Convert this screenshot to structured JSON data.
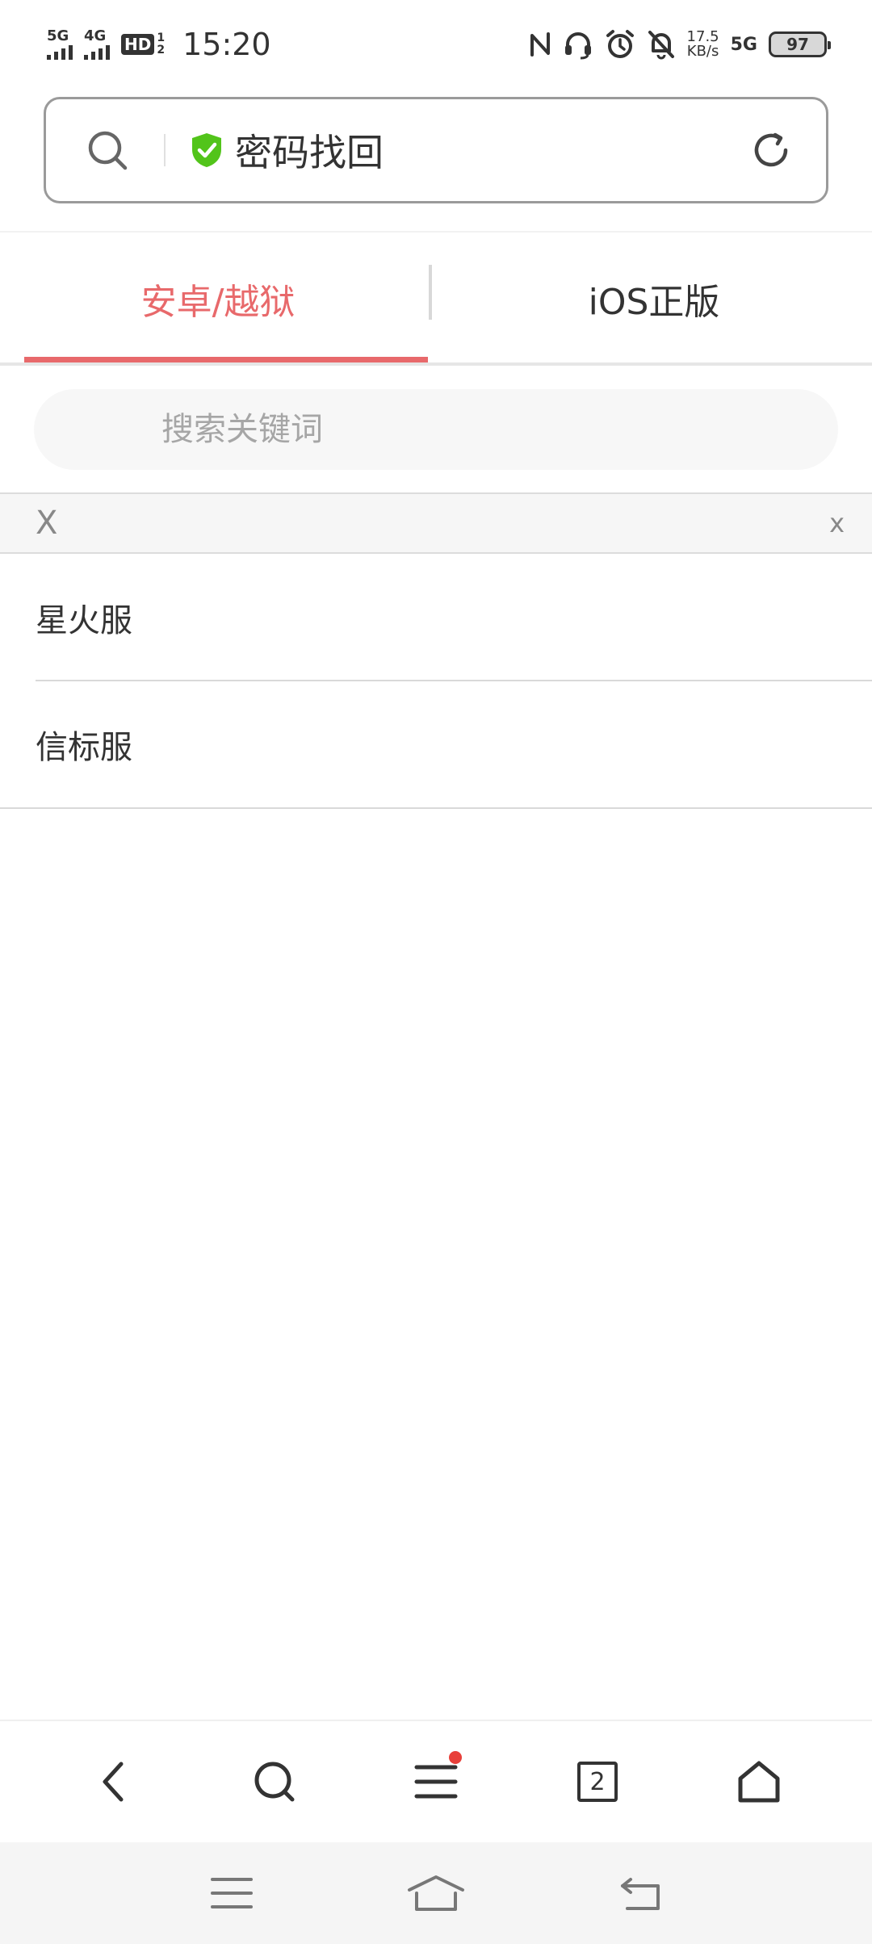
{
  "status_bar": {
    "sim1": "5G",
    "sim2": "4G",
    "hd_label": "HD",
    "hd_top": "1",
    "hd_bottom": "2",
    "time": "15:20",
    "speed_value": "17.5",
    "speed_unit": "KB/s",
    "net_type": "5G",
    "battery": "97",
    "icons": [
      "nfc-icon",
      "headset-icon",
      "alarm-icon",
      "mute-bell-icon"
    ]
  },
  "url_bar": {
    "title": "密码找回",
    "secure_icon": "shield-check-icon",
    "colors": {
      "shield": "#52c41a",
      "border": "#9a9a9a"
    }
  },
  "tabs": [
    {
      "label": "安卓/越狱",
      "active": true
    },
    {
      "label": "iOS正版",
      "active": false
    }
  ],
  "search": {
    "placeholder": "搜索关键词",
    "value": ""
  },
  "filter_bar": {
    "left_text": "X",
    "right_text": "x"
  },
  "list": [
    {
      "label": "星火服"
    },
    {
      "label": "信标服"
    }
  ],
  "browser_nav": {
    "items": [
      "back-icon",
      "search-icon",
      "menu-icon",
      "tabs-icon",
      "home-icon"
    ],
    "tabs_count": "2",
    "menu_badge": true
  },
  "system_nav": {
    "items": [
      "recent-apps-icon",
      "home-icon",
      "back-icon"
    ]
  },
  "colors": {
    "accent": "#e8696b",
    "badge": "#e8403a"
  }
}
